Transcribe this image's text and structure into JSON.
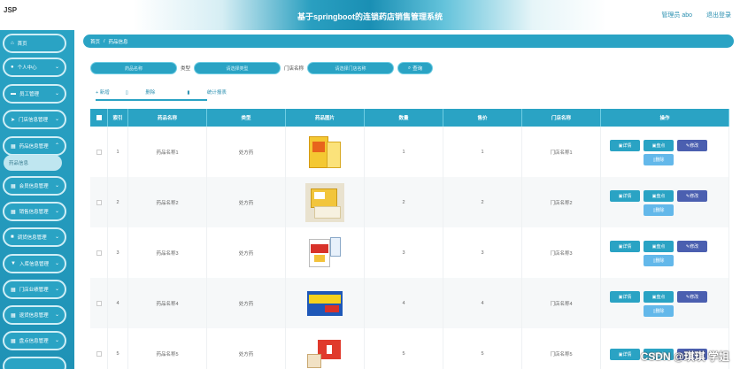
{
  "header": {
    "logo": "JSP",
    "title": "基于springboot的连锁药店销售管理系统",
    "user": "管理员 abo",
    "logout": "退出登录"
  },
  "sidebar": {
    "items": [
      {
        "label": "首页",
        "icon": "home-icon",
        "chev": ""
      },
      {
        "label": "个人中心",
        "icon": "user-icon",
        "chev": "⌄"
      },
      {
        "label": "员工管理",
        "icon": "card-icon",
        "chev": "⌄"
      },
      {
        "label": "门店信息管理",
        "icon": "send-icon",
        "chev": "⌄"
      },
      {
        "label": "药品信息管理",
        "icon": "grid-icon",
        "chev": "⌃"
      },
      {
        "label": "会员信息管理",
        "icon": "grid-icon",
        "chev": "⌄"
      },
      {
        "label": "销售信息管理",
        "icon": "grid-icon",
        "chev": "⌄"
      },
      {
        "label": "调货信息管理",
        "icon": "box-icon",
        "chev": "⌄"
      },
      {
        "label": "入库信息管理",
        "icon": "shield-icon",
        "chev": "⌄"
      },
      {
        "label": "门店业绩管理",
        "icon": "grid-icon",
        "chev": "⌄"
      },
      {
        "label": "退货信息管理",
        "icon": "grid-icon",
        "chev": "⌄"
      },
      {
        "label": "盘点信息管理",
        "icon": "grid-icon",
        "chev": "⌄"
      }
    ],
    "submenu": "药品信息"
  },
  "breadcrumb": {
    "home": "首页",
    "sep": "/",
    "current": "药品信息"
  },
  "search": {
    "name_placeholder": "药品名称",
    "type_label": "类型",
    "type_placeholder": "请选择类型",
    "store_label": "门店名称",
    "store_placeholder": "请选择门店名称",
    "query_label": "查询"
  },
  "actions": {
    "add": "+ 新增",
    "delete": "删除",
    "report": "统计报表"
  },
  "table": {
    "headers": [
      "索引",
      "药品名称",
      "类型",
      "药品图片",
      "数量",
      "售价",
      "门店名称",
      "操作"
    ],
    "rows": [
      {
        "idx": "1",
        "name": "药品名称1",
        "type": "处方药",
        "num": "1",
        "price": "1",
        "store": "门店名称1"
      },
      {
        "idx": "2",
        "name": "药品名称2",
        "type": "处方药",
        "num": "2",
        "price": "2",
        "store": "门店名称2"
      },
      {
        "idx": "3",
        "name": "药品名称3",
        "type": "处方药",
        "num": "3",
        "price": "3",
        "store": "门店名称3"
      },
      {
        "idx": "4",
        "name": "药品名称4",
        "type": "处方药",
        "num": "4",
        "price": "4",
        "store": "门店名称4"
      },
      {
        "idx": "5",
        "name": "药品名称5",
        "type": "处方药",
        "num": "5",
        "price": "5",
        "store": "门店名称5"
      }
    ],
    "ops": {
      "detail": "详情",
      "check": "盘点",
      "edit": "修改",
      "delete": "删除"
    }
  },
  "watermark": "CSDN @琪琪 学姐",
  "colors": {
    "accent": "#2aa3c4",
    "edit": "#4b5fb0",
    "delete": "#63b8ea"
  }
}
